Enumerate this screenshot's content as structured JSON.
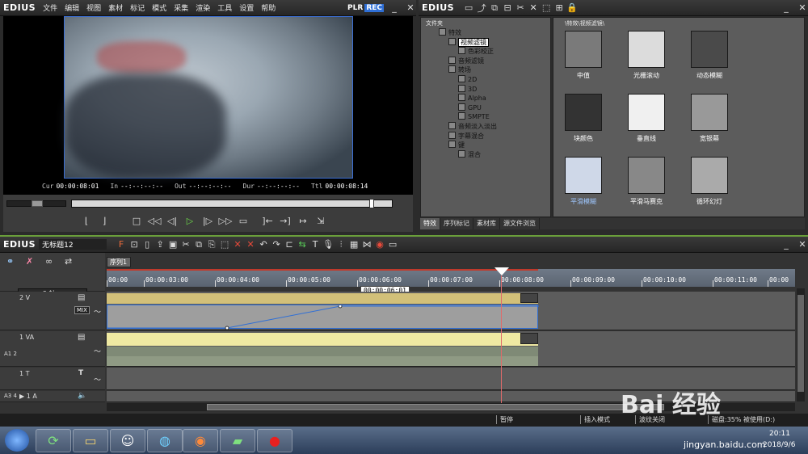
{
  "app": {
    "name": "EDIUS",
    "menu": [
      "文件",
      "编辑",
      "视图",
      "素材",
      "标记",
      "模式",
      "采集",
      "渲染",
      "工具",
      "设置",
      "帮助"
    ],
    "plr_label": "PLR",
    "rec_label": "REC"
  },
  "player": {
    "timecodes": {
      "cur_label": "Cur",
      "cur_value": "00:00:08:01",
      "in_label": "In",
      "in_value": "--:--:--:--",
      "out_label": "Out",
      "out_value": "--:--:--:--",
      "dur_label": "Dur",
      "dur_value": "--:--:--:--",
      "ttl_label": "Ttl",
      "ttl_value": "00:00:08:14"
    },
    "scrub_position": 0.94
  },
  "bin": {
    "title": "EDIUS",
    "folder_header": "文件夹",
    "path": "\\特效\\视频滤镜\\",
    "tree": [
      {
        "label": "特效",
        "level": 0
      },
      {
        "label": "视频滤镜",
        "level": 1,
        "selected": true
      },
      {
        "label": "色彩校正",
        "level": 2
      },
      {
        "label": "音频滤镜",
        "level": 1
      },
      {
        "label": "转场",
        "level": 1
      },
      {
        "label": "2D",
        "level": 2
      },
      {
        "label": "3D",
        "level": 2
      },
      {
        "label": "Alpha",
        "level": 2
      },
      {
        "label": "GPU",
        "level": 2
      },
      {
        "label": "SMPTE",
        "level": 2
      },
      {
        "label": "音频淡入淡出",
        "level": 1
      },
      {
        "label": "字幕混合",
        "level": 1
      },
      {
        "label": "键",
        "level": 1
      },
      {
        "label": "混合",
        "level": 2
      }
    ],
    "effects": [
      "中值",
      "光栅滚动",
      "动态模糊",
      "块颜色",
      "垂直线",
      "宽银幕",
      "平滑模糊",
      "平滑马赛克",
      "循环幻灯"
    ],
    "tabs": [
      "特效",
      "序列标记",
      "素材库",
      "源文件浏览"
    ]
  },
  "timeline": {
    "title": "EDIUS",
    "project_name": "无标题12",
    "sequence_tab": "序列1",
    "channel_label": "5 轴",
    "ruler_labels": [
      "00:00",
      "00:00:03:00",
      "00:00:04:00",
      "00:00:05:00",
      "00:00:06:00",
      "00:00:07:00",
      "00:00:08:00",
      "00:00:09:00",
      "00:00:10:00",
      "00:00:11:00",
      "00:00"
    ],
    "hover_tooltip": "00:00:06:01",
    "tracks": [
      {
        "name": "2 V",
        "badge": "MIX"
      },
      {
        "name": "1 VA",
        "side_label": "A1 2"
      },
      {
        "name": "1 T",
        "badge": "T"
      },
      {
        "name": "▶ 1 A",
        "side_label": "A3 4"
      }
    ]
  },
  "status": {
    "items": [
      "暂停",
      "插入模式",
      "波纹关闭",
      "磁盘:35% 被使用(D:)"
    ]
  },
  "taskbar": {
    "time": "20:11",
    "date": "2018/9/6",
    "watermark": "Bai 经验",
    "watermark_url": "jingyan.baidu.com"
  }
}
